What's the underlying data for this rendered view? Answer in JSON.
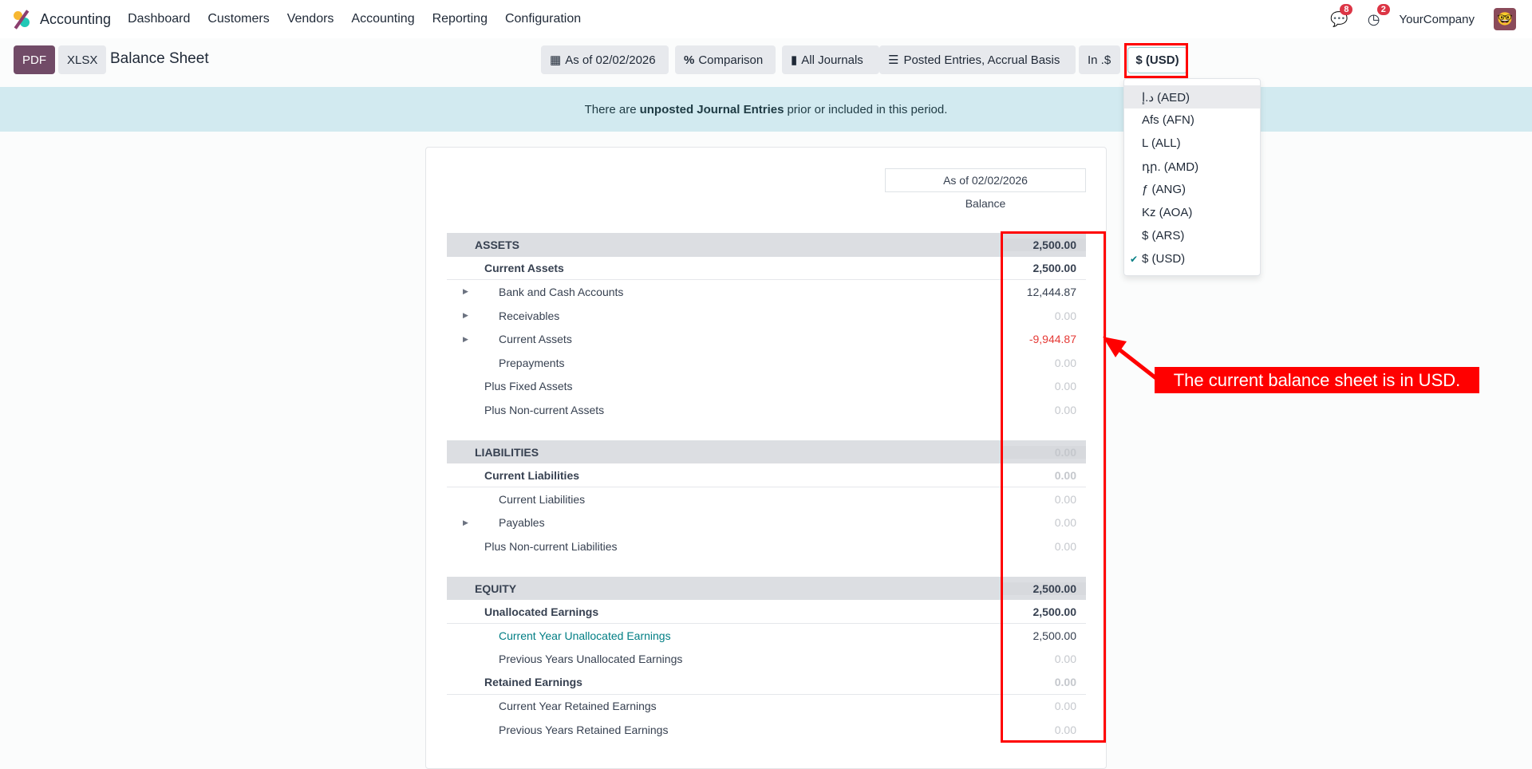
{
  "nav": {
    "app": "Accounting",
    "menu": [
      "Dashboard",
      "Customers",
      "Vendors",
      "Accounting",
      "Reporting",
      "Configuration"
    ],
    "messages_count": "8",
    "activities_count": "2",
    "company": "YourCompany"
  },
  "toolbar": {
    "pdf": "PDF",
    "xlsx": "XLSX",
    "title": "Balance Sheet",
    "date": "As of 02/02/2026",
    "comparison": "Comparison",
    "journals": "All Journals",
    "entries": "Posted Entries, Accrual Basis",
    "in_currency": "In .$",
    "currency": "$ (USD)"
  },
  "alert": {
    "pre": "There are ",
    "bold": "unposted Journal Entries",
    "post": " prior or included in this period."
  },
  "report": {
    "column_header": "As of 02/02/2026",
    "column_sub": "Balance",
    "rows": [
      {
        "t": "section",
        "label": "Assets",
        "amt": "2,500.00"
      },
      {
        "t": "subtotal",
        "label": "Current Assets",
        "amt": "2,500.00"
      },
      {
        "t": "line",
        "label": "Bank and Cash Accounts",
        "amt": "12,444.87",
        "caret": true
      },
      {
        "t": "line",
        "label": "Receivables",
        "amt": "0.00",
        "caret": true
      },
      {
        "t": "line",
        "label": "Current Assets",
        "amt": "-9,944.87",
        "caret": true
      },
      {
        "t": "line",
        "label": "Prepayments",
        "amt": "0.00"
      },
      {
        "t": "plus",
        "label": "Plus Fixed Assets",
        "amt": "0.00"
      },
      {
        "t": "plus",
        "label": "Plus Non-current Assets",
        "amt": "0.00"
      },
      {
        "t": "spacer"
      },
      {
        "t": "section",
        "label": "Liabilities",
        "amt": "0.00"
      },
      {
        "t": "subtotal",
        "label": "Current Liabilities",
        "amt": "0.00"
      },
      {
        "t": "line",
        "label": "Current Liabilities",
        "amt": "0.00"
      },
      {
        "t": "line",
        "label": "Payables",
        "amt": "0.00",
        "caret": true
      },
      {
        "t": "plus",
        "label": "Plus Non-current Liabilities",
        "amt": "0.00"
      },
      {
        "t": "spacer"
      },
      {
        "t": "section",
        "label": "Equity",
        "amt": "2,500.00"
      },
      {
        "t": "subtotal",
        "label": "Unallocated Earnings",
        "amt": "2,500.00"
      },
      {
        "t": "line",
        "label": "Current Year Unallocated Earnings",
        "amt": "2,500.00",
        "link": true
      },
      {
        "t": "line",
        "label": "Previous Years Unallocated Earnings",
        "amt": "0.00"
      },
      {
        "t": "subtotal",
        "label": "Retained Earnings",
        "amt": "0.00"
      },
      {
        "t": "line",
        "label": "Current Year Retained Earnings",
        "amt": "0.00"
      },
      {
        "t": "line",
        "label": "Previous Years Retained Earnings",
        "amt": "0.00"
      }
    ]
  },
  "currency_dropdown": {
    "options": [
      "د.إ (AED)",
      "Afs (AFN)",
      "L (ALL)",
      "դր. (AMD)",
      "ƒ (ANG)",
      "Kz (AOA)",
      "$ (ARS)",
      "$ (USD)"
    ],
    "selected": "$ (USD)"
  },
  "annotation": "The current balance sheet is in USD.",
  "colors": {
    "accent": "#714b67",
    "annotation": "#ff0000",
    "negative": "#e53935"
  }
}
